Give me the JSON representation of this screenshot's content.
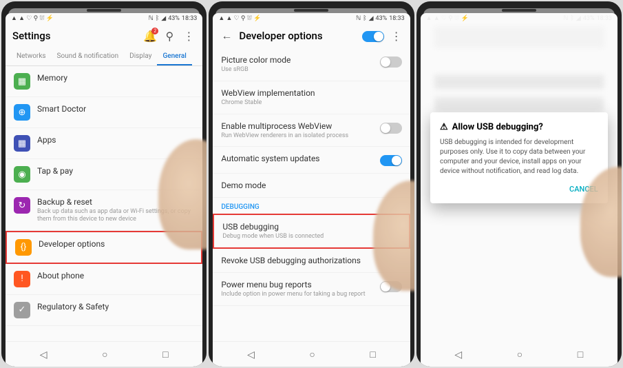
{
  "status": {
    "left": "▲ ▲ ♡ ⚲ ⛆ ⚡",
    "signal": "◢",
    "batt": "43%",
    "time": "18:33",
    "bt": "ᛒ",
    "nfc": "ℕ"
  },
  "p1": {
    "title": "Settings",
    "tabs": [
      "Networks",
      "Sound & notification",
      "Display",
      "General"
    ],
    "items": [
      {
        "icon": "▦",
        "color": "#4caf50",
        "title": "Memory"
      },
      {
        "icon": "⊕",
        "color": "#2196f3",
        "title": "Smart Doctor"
      },
      {
        "icon": "▦",
        "color": "#3f51b5",
        "title": "Apps"
      },
      {
        "icon": "◉",
        "color": "#4caf50",
        "title": "Tap & pay"
      },
      {
        "icon": "↻",
        "color": "#9c27b0",
        "title": "Backup & reset",
        "sub": "Back up data such as app data or Wi-Fi settings, or copy them from this device to new device"
      },
      {
        "icon": "{}",
        "color": "#ff9800",
        "title": "Developer options",
        "hl": true
      },
      {
        "icon": "!",
        "color": "#ff5722",
        "title": "About phone"
      },
      {
        "icon": "✓",
        "color": "#9e9e9e",
        "title": "Regulatory & Safety"
      }
    ]
  },
  "p2": {
    "title": "Developer options",
    "items": [
      {
        "title": "Picture color mode",
        "sub": "Use sRGB",
        "toggle": false
      },
      {
        "title": "WebView implementation",
        "sub": "Chrome Stable"
      },
      {
        "title": "Enable multiprocess WebView",
        "sub": "Run WebView renderers in an isolated process",
        "toggle": false
      },
      {
        "title": "Automatic system updates",
        "toggle": true
      },
      {
        "title": "Demo mode"
      }
    ],
    "section": "DEBUGGING",
    "items2": [
      {
        "title": "USB debugging",
        "sub": "Debug mode when USB is connected",
        "hl": true
      },
      {
        "title": "Revoke USB debugging authorizations"
      },
      {
        "title": "Power menu bug reports",
        "sub": "Include option in power menu for taking a bug report",
        "toggle": false
      }
    ]
  },
  "p3": {
    "title": "Allow USB debugging?",
    "body": "USB debugging is intended for development purposes only. Use it to copy data between your computer and your device, install apps on your device without notification, and read log data.",
    "cancel": "CANCEL"
  },
  "nav": {
    "back": "◁",
    "home": "○",
    "recent": "□"
  }
}
